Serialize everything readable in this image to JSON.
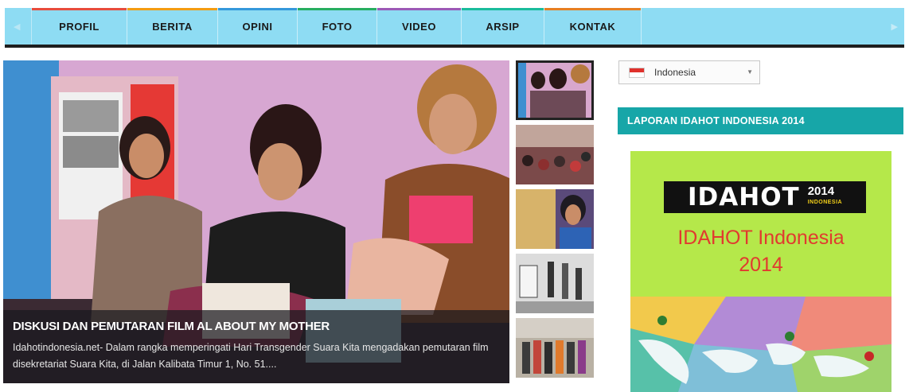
{
  "nav": {
    "items": [
      {
        "label": "PROFIL",
        "accent": "#e74c3c"
      },
      {
        "label": "BERITA",
        "accent": "#f39c12"
      },
      {
        "label": "OPINI",
        "accent": "#3498db"
      },
      {
        "label": "FOTO",
        "accent": "#27ae60"
      },
      {
        "label": "VIDEO",
        "accent": "#9b59b6"
      },
      {
        "label": "ARSIP",
        "accent": "#1abc9c"
      },
      {
        "label": "KONTAK",
        "accent": "#e67e22"
      }
    ]
  },
  "featured": {
    "title": "DISKUSI DAN PEMUTARAN FILM AL ABOUT MY MOTHER",
    "excerpt": "Idahotindonesia.net- Dalam rangka memperingati Hari Transgender Suara Kita mengadakan pemutaran film disekretariat Suara Kita, di Jalan Kalibata Timur 1, No. 51...."
  },
  "language": {
    "selected": "Indonesia"
  },
  "widget": {
    "title": "LAPORAN IDAHOT INDONESIA 2014",
    "poster_logo": "IDAHOT",
    "poster_year": "2014",
    "poster_year_sub": "INDONESIA",
    "poster_line1": "IDAHOT Indonesia",
    "poster_line2": "2014"
  },
  "colors": {
    "nav_bg": "#8edcf3",
    "widget_bg": "#17a6a8",
    "poster_bg": "#b5e84a",
    "poster_text": "#e13a2f"
  }
}
